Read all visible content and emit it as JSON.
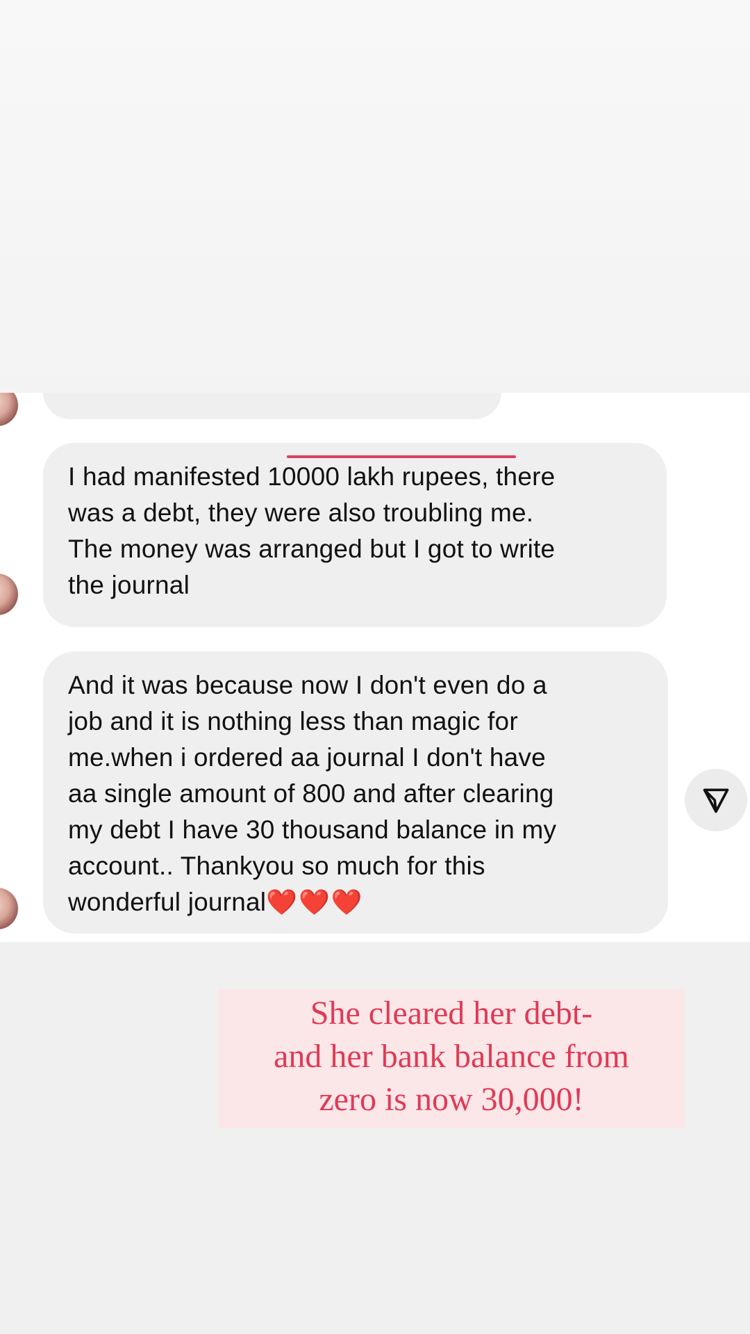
{
  "messages": [
    {
      "lines": [
        "I had manifested 10000 lakh rupees, there",
        "was a debt, they were also troubling me.",
        "The money was arranged but I got to write",
        "the journal"
      ]
    },
    {
      "lines": [
        "And it was because now I don't even do a",
        "job and it is nothing less than magic for",
        "me.when i ordered aa journal I don't have",
        "aa single amount of 800 and after clearing",
        "my debt I have 30 thousand balance in my",
        "account.. Thankyou so much for this",
        "wonderful journal"
      ],
      "hearts": "❤️❤️❤️"
    }
  ],
  "caption": {
    "lines": [
      "She cleared her debt-",
      "and her bank balance from",
      "zero is now 30,000!"
    ]
  },
  "icons": {
    "share": "share-paper-plane-icon",
    "avatar": "profile-avatar"
  },
  "colors": {
    "accent": "#e03a55",
    "caption_bg": "#fbe6e8",
    "bubble_bg": "#efefef"
  }
}
